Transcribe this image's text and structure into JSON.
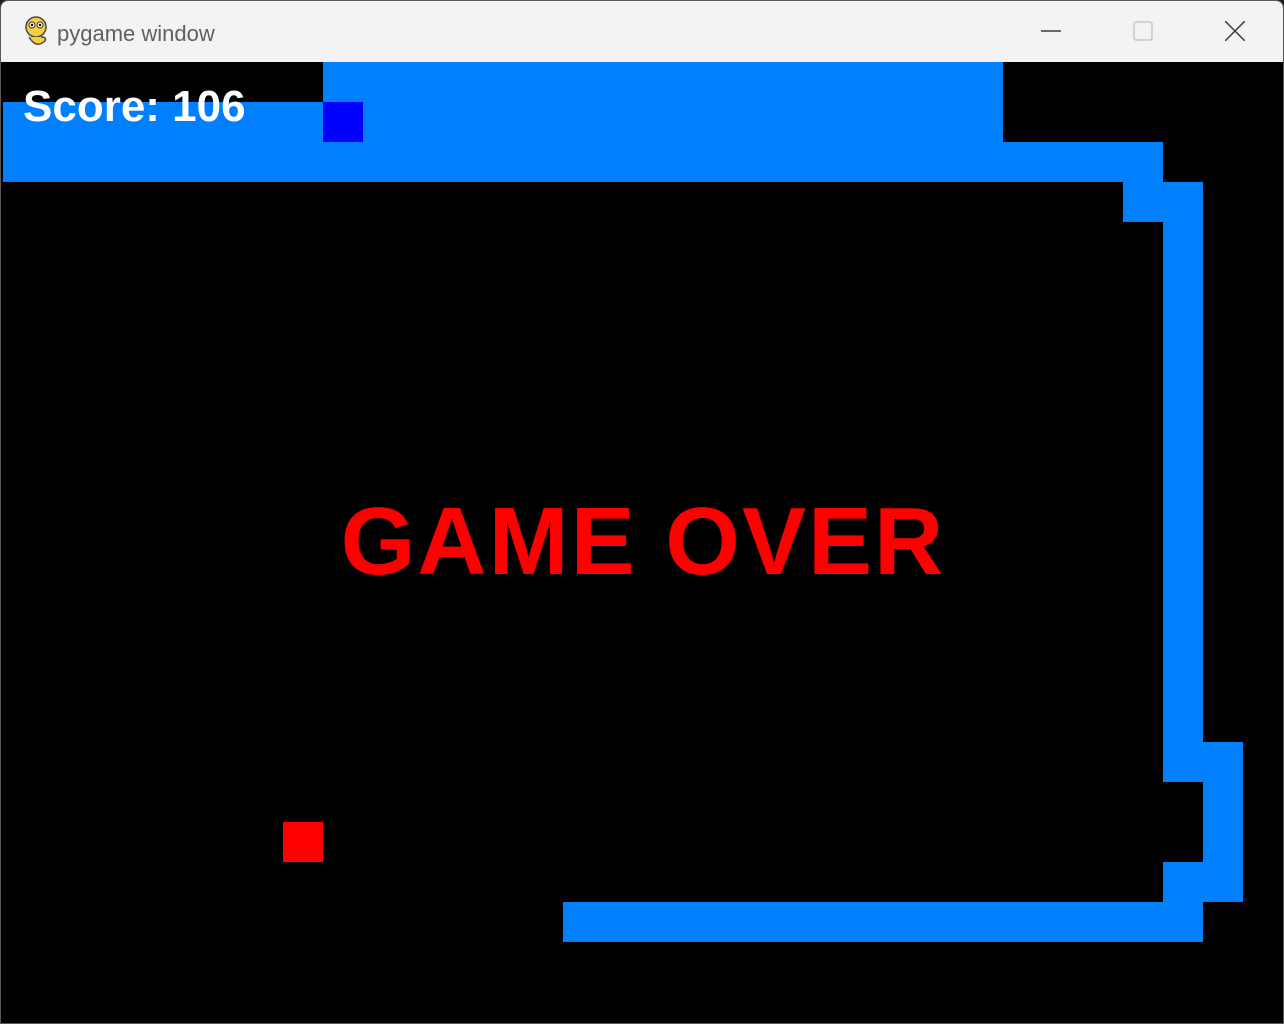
{
  "window": {
    "title": "pygame window",
    "icon": "pygame-snake-icon",
    "controls": [
      "minimize-icon",
      "maximize-icon",
      "close-icon"
    ]
  },
  "game": {
    "score_text": "Score: 106",
    "status_text": "GAME OVER",
    "colors": {
      "background": "#000000",
      "snake_body": "#0080ff",
      "snake_head": "#0000ff",
      "food": "#ff0000",
      "score_text": "#ffffff",
      "status_text": "#ff0000"
    }
  }
}
